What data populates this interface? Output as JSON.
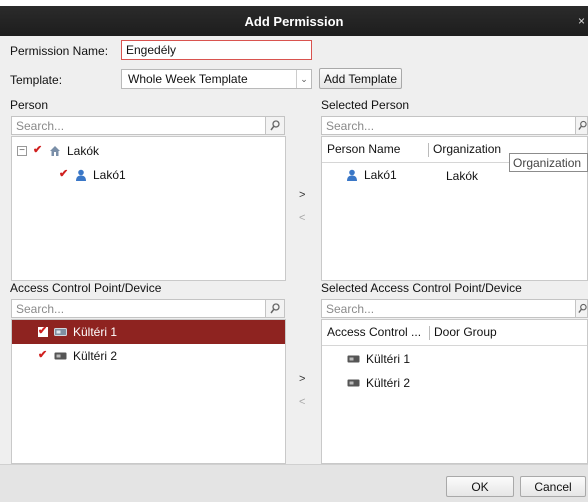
{
  "window": {
    "title": "Add Permission",
    "close_glyph": "×"
  },
  "form": {
    "permission_name_label": "Permission Name:",
    "permission_name_value": "Engedély",
    "template_label": "Template:",
    "template_value": "Whole Week Template",
    "add_template_label": "Add Template"
  },
  "person": {
    "label": "Person",
    "search_placeholder": "Search...",
    "tree": [
      {
        "label": "Lakók",
        "icon": "house-icon",
        "checked": true,
        "expanded": true
      },
      {
        "label": "Lakó1",
        "icon": "person-icon",
        "checked": true
      }
    ]
  },
  "selected_person": {
    "label": "Selected Person",
    "search_placeholder": "Search...",
    "columns": [
      "Person Name",
      "Organization"
    ],
    "tooltip": "Organization",
    "rows": [
      {
        "name": "Lakó1",
        "organization": "Lakók"
      }
    ]
  },
  "transfer": {
    "add": ">",
    "remove": "<"
  },
  "device": {
    "label": "Access Control Point/Device",
    "search_placeholder": "Search...",
    "items": [
      {
        "label": "Kültéri 1",
        "checked": true,
        "selected": true
      },
      {
        "label": "Kültéri 2",
        "checked": true,
        "selected": false
      }
    ]
  },
  "selected_device": {
    "label": "Selected Access Control Point/Device",
    "search_placeholder": "Search...",
    "columns": [
      "Access Control ...",
      "Door Group"
    ],
    "rows": [
      {
        "name": "Kültéri 1"
      },
      {
        "name": "Kültéri 2"
      }
    ]
  },
  "footer": {
    "ok_label": "OK",
    "cancel_label": "Cancel"
  },
  "colors": {
    "accent_red": "#d0201f",
    "selected_row": "#8e2320",
    "titlebar": "#232323"
  }
}
